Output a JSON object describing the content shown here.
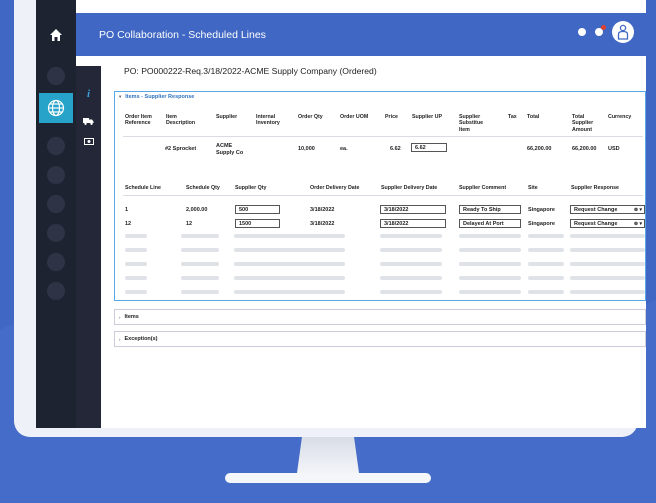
{
  "app": {
    "title": "PO Collaboration - Scheduled Lines"
  },
  "po": {
    "title": "PO: PO000222-Req.3/18/2022-ACME Supply Company (Ordered)"
  },
  "panels": {
    "supplier_response": "Items - Supplier Response",
    "items": "Items",
    "exceptions": "Exception(s)"
  },
  "item_table": {
    "headers": [
      "Order Item Reference",
      "Item Description",
      "Supplier",
      "Internal Inventory",
      "Order Qty",
      "Order UOM",
      "Price",
      "Supplier UP",
      "Supplier Substitue Item",
      "Tax",
      "Total",
      "Total Supplier Amount",
      "Currency"
    ],
    "row": {
      "item_description": "#2 Sprocket",
      "supplier": "ACME Supply Co",
      "order_qty": "10,000",
      "order_uom": "ea.",
      "price": "6.62",
      "supplier_up": "6.62",
      "total": "66,200.00",
      "total_supplier_amount": "66,200.00",
      "currency": "USD"
    }
  },
  "schedule_table": {
    "headers": [
      "Schedule Line",
      "Schedule Qty",
      "Supplier Qty",
      "Order Delivery Date",
      "Supplier Delivery Date",
      "Supplier Comment",
      "Site",
      "Supplier Response"
    ],
    "rows": [
      {
        "line": "1",
        "qty": "2,000.00",
        "supplier_qty": "500",
        "order_date": "3/18/2022",
        "supplier_date": "3/18/2022",
        "comment": "Ready To Ship",
        "site": "Singapore",
        "response": "Request Change"
      },
      {
        "line": "12",
        "qty": "12",
        "supplier_qty": "1500",
        "order_date": "3/18/2022",
        "supplier_date": "3/18/2022",
        "comment": "Delayed At Port",
        "site": "Singapore",
        "response": "Request Change"
      }
    ]
  },
  "icons": [
    "home-icon",
    "globe-icon",
    "info-icon",
    "truck-icon",
    "money-icon",
    "notification-icon",
    "user-avatar-icon"
  ],
  "colors": {
    "brand": "#3f67c3",
    "accent": "#27a3c9",
    "sidebar": "#1e2332"
  }
}
